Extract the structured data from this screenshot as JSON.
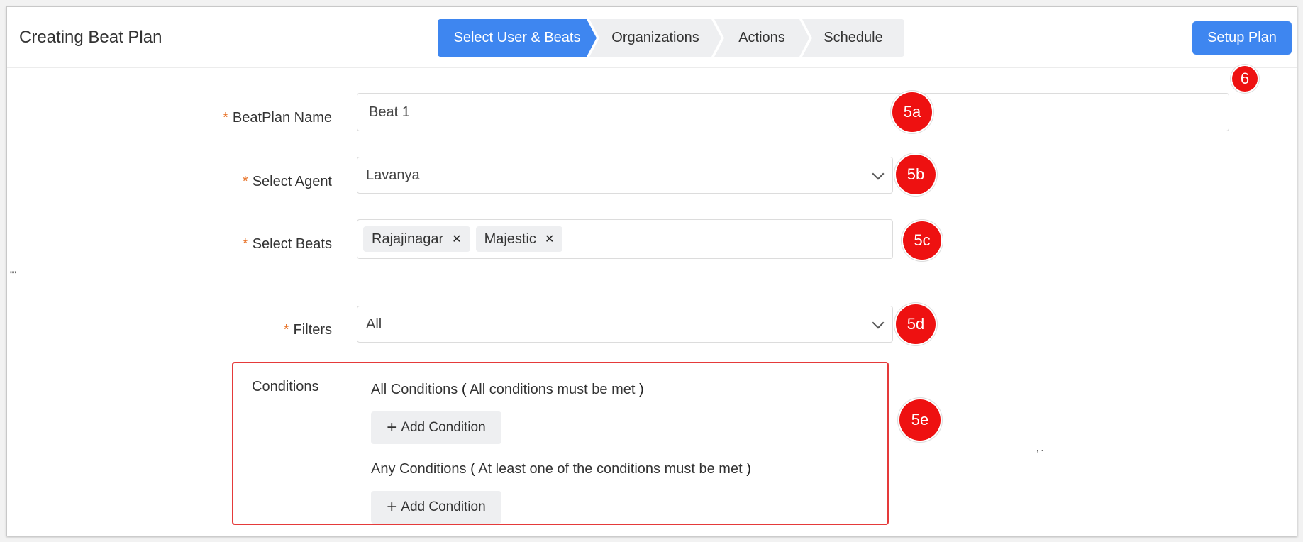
{
  "header": {
    "title": "Creating Beat Plan",
    "steps": [
      "Select User & Beats",
      "Organizations",
      "Actions",
      "Schedule"
    ],
    "setup_button": "Setup Plan"
  },
  "annotations": {
    "a6": "6",
    "a5a": "5a",
    "a5b": "5b",
    "a5c": "5c",
    "a5d": "5d",
    "a5e": "5e"
  },
  "form": {
    "required_mark": "*",
    "beatplan_name": {
      "label": "BeatPlan Name",
      "value": "Beat 1"
    },
    "agent": {
      "label": "Select Agent",
      "value": "Lavanya"
    },
    "beats": {
      "label": "Select Beats",
      "tags": [
        "Rajajinagar",
        "Majestic"
      ]
    },
    "filters": {
      "label": "Filters",
      "value": "All"
    }
  },
  "conditions": {
    "label": "Conditions",
    "all_title": "All Conditions",
    "all_desc": "All conditions must be met",
    "any_title": "Any Conditions",
    "any_desc": "At least one of the conditions must be met",
    "add_button": "Add Condition"
  },
  "colors": {
    "primary": "#3e86f0",
    "badge": "#ee1111",
    "required": "#e8742a",
    "highlight_border": "#e53a3a"
  },
  "stray_marks": {
    "left": "\"\"",
    "right": ", ."
  }
}
